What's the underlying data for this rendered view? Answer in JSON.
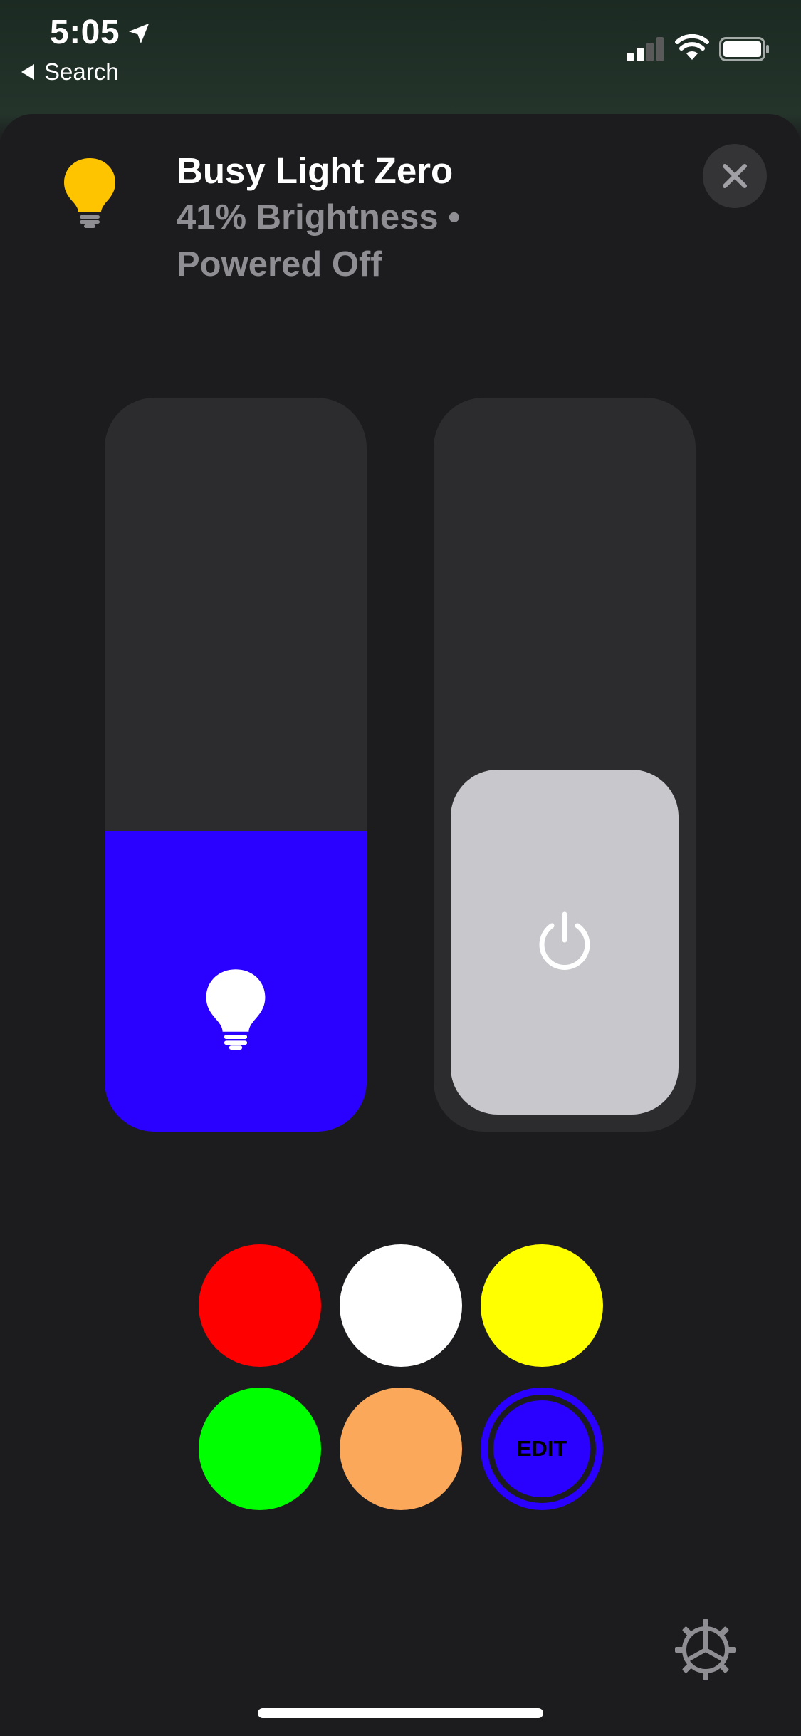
{
  "status_bar": {
    "time": "5:05",
    "back_label": "Search",
    "location_icon": "location-arrow-icon",
    "signal_icon": "cellular-signal-icon",
    "wifi_icon": "wifi-icon",
    "battery_icon": "battery-icon"
  },
  "header": {
    "title": "Busy Light Zero",
    "subtitle": "41% Brightness • Powered Off",
    "icon": "lightbulb-icon",
    "icon_color": "#ffc400",
    "close_icon": "close-icon"
  },
  "brightness": {
    "level_fraction": 0.41,
    "fill_color": "#2a00ff",
    "icon": "lightbulb-icon"
  },
  "power": {
    "state": "off",
    "icon": "power-icon"
  },
  "swatches": [
    {
      "name": "red",
      "color": "#ff0000"
    },
    {
      "name": "white",
      "color": "#ffffff"
    },
    {
      "name": "yellow",
      "color": "#ffff00"
    },
    {
      "name": "green",
      "color": "#00ff00"
    },
    {
      "name": "orange",
      "color": "#fba85a"
    }
  ],
  "edit_swatch": {
    "label": "EDIT",
    "color": "#2a00ff"
  },
  "settings_icon": "gear-icon"
}
